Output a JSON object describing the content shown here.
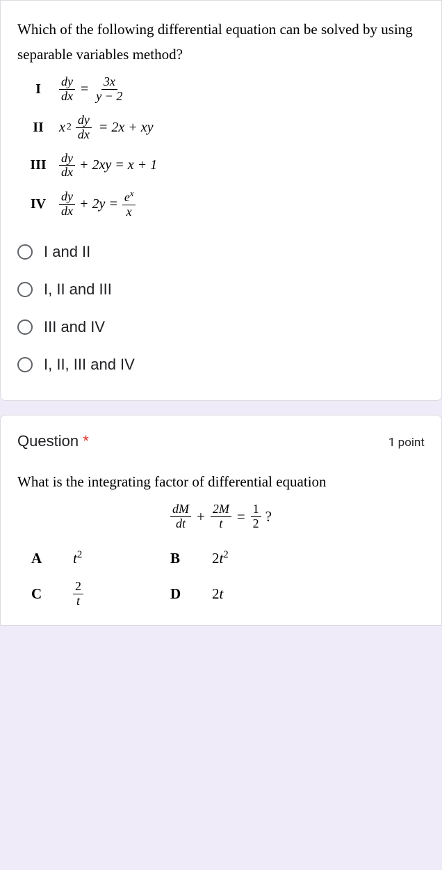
{
  "q1": {
    "prompt": "Which of the following differential equation can be solved by using separable variables method?",
    "rows": {
      "r1": "I",
      "r2": "II",
      "r3": "III",
      "r4": "IV"
    },
    "eq1": {
      "dy": "dy",
      "dx": "dx",
      "eq": "=",
      "num": "3x",
      "den": "y − 2"
    },
    "eq2": {
      "x2": "x",
      "sup": "2",
      "dy": "dy",
      "dx": "dx",
      "rhs": "= 2x + xy"
    },
    "eq3": {
      "dy": "dy",
      "dx": "dx",
      "rhs": "+ 2xy = x + 1"
    },
    "eq4": {
      "dy": "dy",
      "dx": "dx",
      "mid": "+ 2y =",
      "enum": "e",
      "esup": "x",
      "eden": "x"
    },
    "options": {
      "a": "I and II",
      "b": "I, II and III",
      "c": "III and IV",
      "d": "I, II, III and IV"
    }
  },
  "q2": {
    "title": "Question",
    "star": "*",
    "points": "1 point",
    "prompt": "What is the integrating factor of differential equation",
    "eq": {
      "dM": "dM",
      "dt": "dt",
      "plus": "+",
      "n2M": "2M",
      "dt2": "t",
      "eq": "=",
      "half_n": "1",
      "half_d": "2",
      "qm": "?"
    },
    "answers": {
      "A": {
        "lbl": "A",
        "t": "t",
        "sup": "2"
      },
      "B": {
        "lbl": "B",
        "pre": "2",
        "t": "t",
        "sup": "2"
      },
      "C": {
        "lbl": "C",
        "num": "2",
        "den": "t"
      },
      "D": {
        "lbl": "D",
        "pre": "2",
        "t": "t"
      }
    }
  }
}
